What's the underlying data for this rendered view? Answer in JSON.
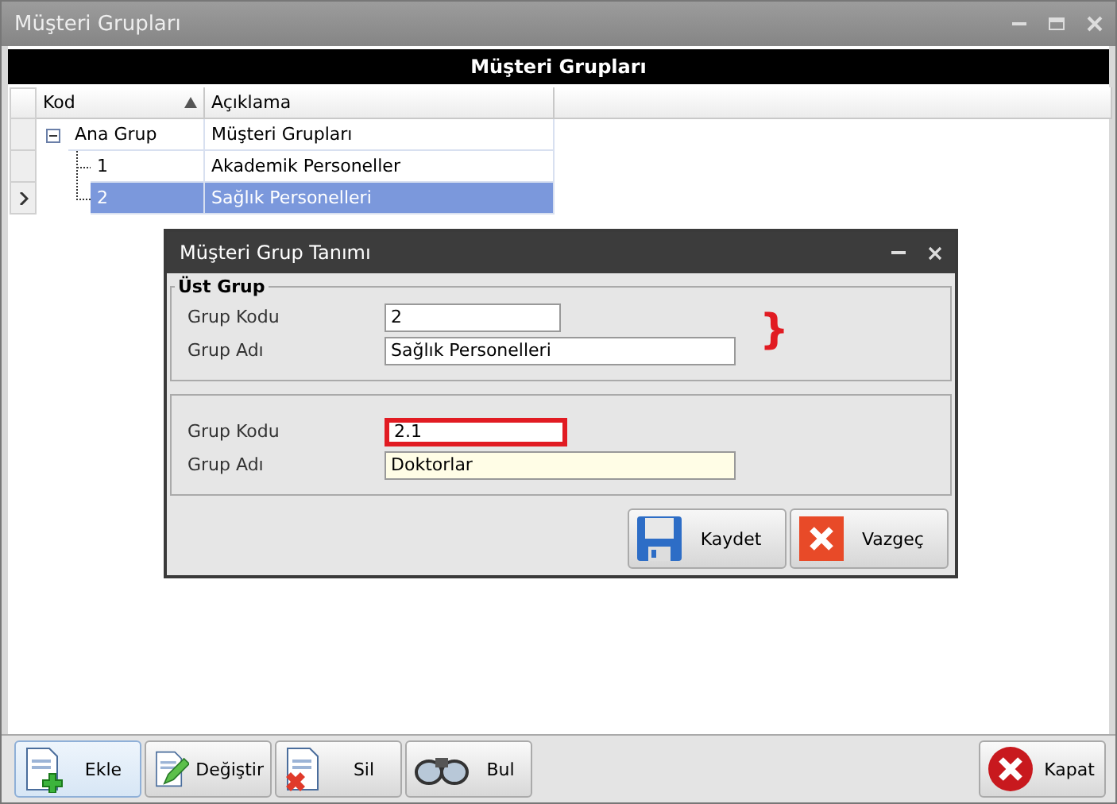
{
  "window": {
    "title": "Müşteri Grupları"
  },
  "header": {
    "title": "Müşteri Grupları"
  },
  "grid": {
    "columns": [
      {
        "label": "Kod",
        "sorted_ascending": true
      },
      {
        "label": "Açıklama",
        "sorted_ascending": false
      }
    ],
    "rows": [
      {
        "code": "Ana Grup",
        "description": "Müşteri Grupları",
        "selected": false,
        "expanded": true,
        "children": [
          {
            "code": "1",
            "description": "Akademik Personeller",
            "selected": false
          },
          {
            "code": "2",
            "description": "Sağlık Personelleri",
            "selected": true
          }
        ]
      }
    ]
  },
  "dialog": {
    "title": "Müşteri Grup Tanımı",
    "groups": [
      {
        "legend": "Üst Grup",
        "brace": "}",
        "fields": [
          {
            "label": "Grup Kodu",
            "value": "2",
            "highlighted": false,
            "focused": false
          },
          {
            "label": "Grup Adı",
            "value": "Sağlık Personelleri",
            "highlighted": false,
            "focused": false
          }
        ]
      },
      {
        "fields": [
          {
            "label": "Grup Kodu",
            "value": "2.1",
            "highlighted": true,
            "focused": false
          },
          {
            "label": "Grup Adı",
            "value": "Doktorlar",
            "highlighted": false,
            "focused": true
          }
        ]
      }
    ],
    "buttons": [
      {
        "kind": "save",
        "label": "Kaydet"
      },
      {
        "kind": "cancel",
        "label": "Vazgeç"
      }
    ]
  },
  "toolbar": {
    "buttons": [
      {
        "kind": "add",
        "label": "Ekle",
        "selected": true
      },
      {
        "kind": "edit",
        "label": "Değiştir",
        "selected": false
      },
      {
        "kind": "delete",
        "label": "Sil",
        "selected": false
      },
      {
        "kind": "find",
        "label": "Bul",
        "selected": false
      }
    ],
    "close": {
      "kind": "close",
      "label": "Kapat"
    }
  }
}
